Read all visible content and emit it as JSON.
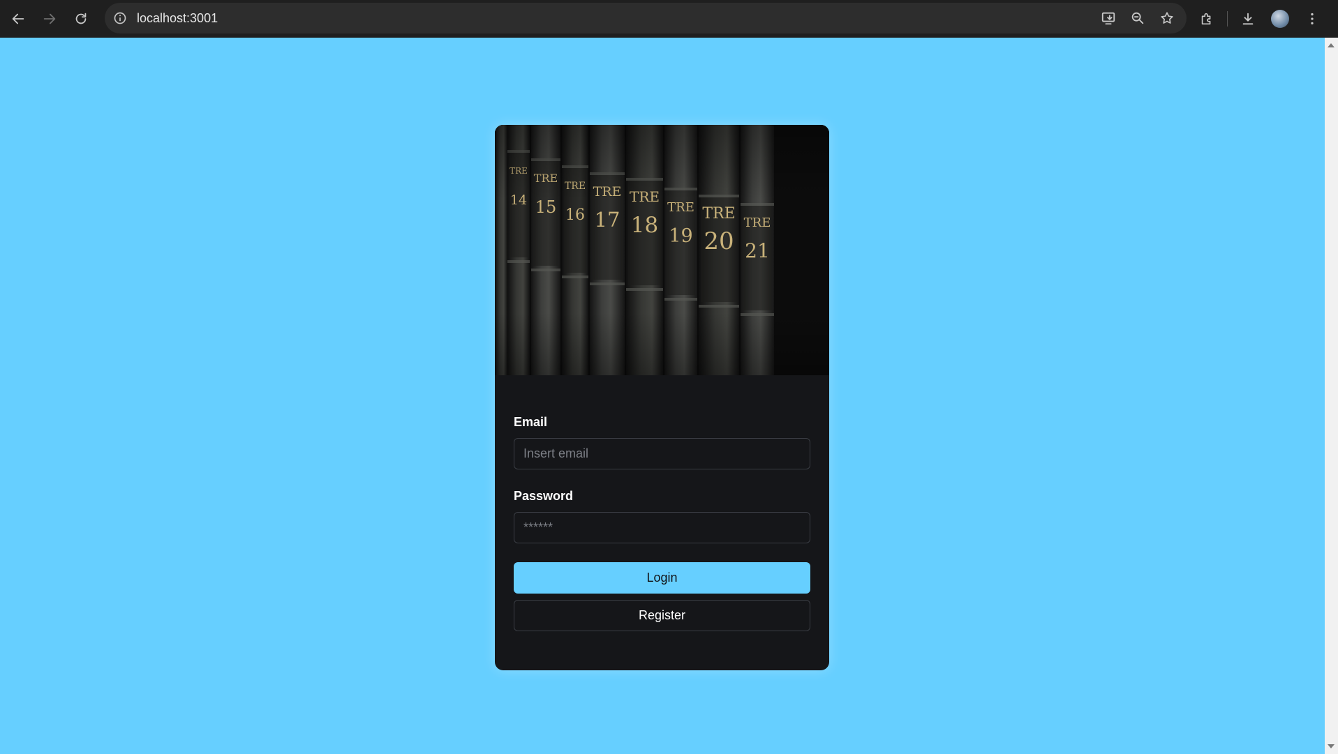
{
  "browser": {
    "url": "localhost:3001",
    "icons": {
      "back": "arrow-left-icon",
      "forward": "arrow-right-icon",
      "reload": "reload-icon",
      "site_info": "info-icon",
      "install": "install-app-icon",
      "zoom": "zoom-icon",
      "bookmark": "star-icon",
      "extensions": "puzzle-icon",
      "downloads": "download-icon",
      "menu": "kebab-menu-icon"
    }
  },
  "page": {
    "background": "#66cfff"
  },
  "login": {
    "email_label": "Email",
    "email_placeholder": "Insert email",
    "email_value": "",
    "password_label": "Password",
    "password_placeholder": "******",
    "password_value": "",
    "login_button": "Login",
    "register_button": "Register",
    "accent": "#66cfff",
    "card_background": "#151619"
  },
  "hero": {
    "description_icon": "books-image",
    "spines": [
      "TRE 14",
      "TRE 15",
      "TRE 16",
      "TRE 17",
      "TRE 18",
      "TRE 19",
      "TRE 20",
      "TRE 21"
    ]
  }
}
